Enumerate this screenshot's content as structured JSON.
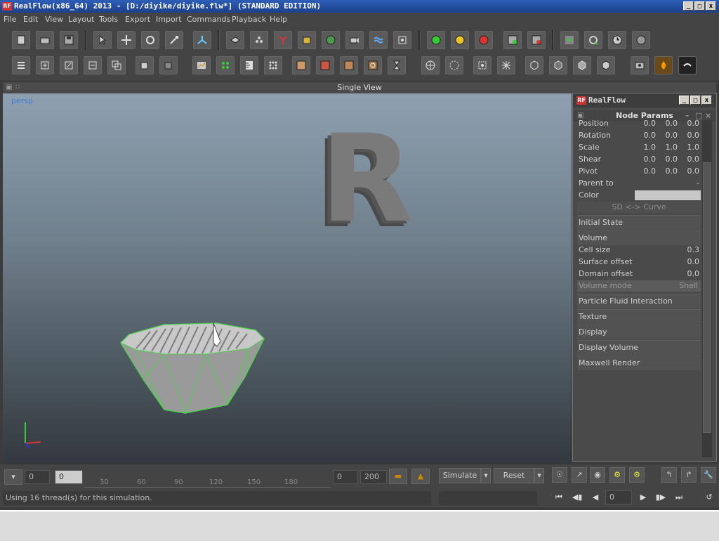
{
  "window": {
    "title": "RealFlow(x86_64) 2013 - [D:/diyike/diyike.flw*] (STANDARD EDITION)",
    "logo": "RF"
  },
  "menu": [
    "File",
    "Edit",
    "View",
    "Layout",
    "Tools",
    "Export",
    "Import",
    "Commands",
    "Playback",
    "Help"
  ],
  "viewport": {
    "header": "Single View",
    "camera_label": "persp",
    "object_letter": "R"
  },
  "panel": {
    "title": "RealFlow",
    "logo": "RF",
    "subtitle": "Node Params",
    "transform_rows": [
      {
        "label": "Position",
        "values": [
          "0.0",
          "0.0",
          "0.0"
        ]
      },
      {
        "label": "Rotation",
        "values": [
          "0.0",
          "0.0",
          "0.0"
        ]
      },
      {
        "label": "Scale",
        "values": [
          "1.0",
          "1.0",
          "1.0"
        ]
      },
      {
        "label": "Shear",
        "values": [
          "0.0",
          "0.0",
          "0.0"
        ]
      },
      {
        "label": "Pivot",
        "values": [
          "0.0",
          "0.0",
          "0.0"
        ]
      }
    ],
    "parent_to": {
      "label": "Parent to",
      "value": "-"
    },
    "color": {
      "label": "Color",
      "value": "#c8c8c8"
    },
    "sd_curve": "SD <-> Curve",
    "initial_state": "Initial State",
    "volume": "Volume",
    "volume_rows": [
      {
        "label": "Cell size",
        "value": "0.3"
      },
      {
        "label": "Surface offset",
        "value": "0.0"
      },
      {
        "label": "Domain offset",
        "value": "0.0"
      },
      {
        "label": "Volume mode",
        "value": "Shell"
      }
    ],
    "sections": [
      "Particle Fluid Interaction",
      "Texture",
      "Display",
      "Display Volume",
      "Maxwell Render"
    ]
  },
  "timeline": {
    "start_field": "0",
    "current_field": "0",
    "ticks": [
      "30",
      "60",
      "90",
      "120",
      "150",
      "180"
    ],
    "range_start": "0",
    "range_end": "200",
    "simulate_label": "Simulate",
    "reset_label": "Reset"
  },
  "status": {
    "message": "Using 16 thread(s) for this simulation.",
    "frame": "0"
  },
  "colors": {
    "accent_blue": "#3f7ed8",
    "mesh_green": "#4fd04f",
    "record_red": "#d33",
    "play_green": "#3c3"
  }
}
